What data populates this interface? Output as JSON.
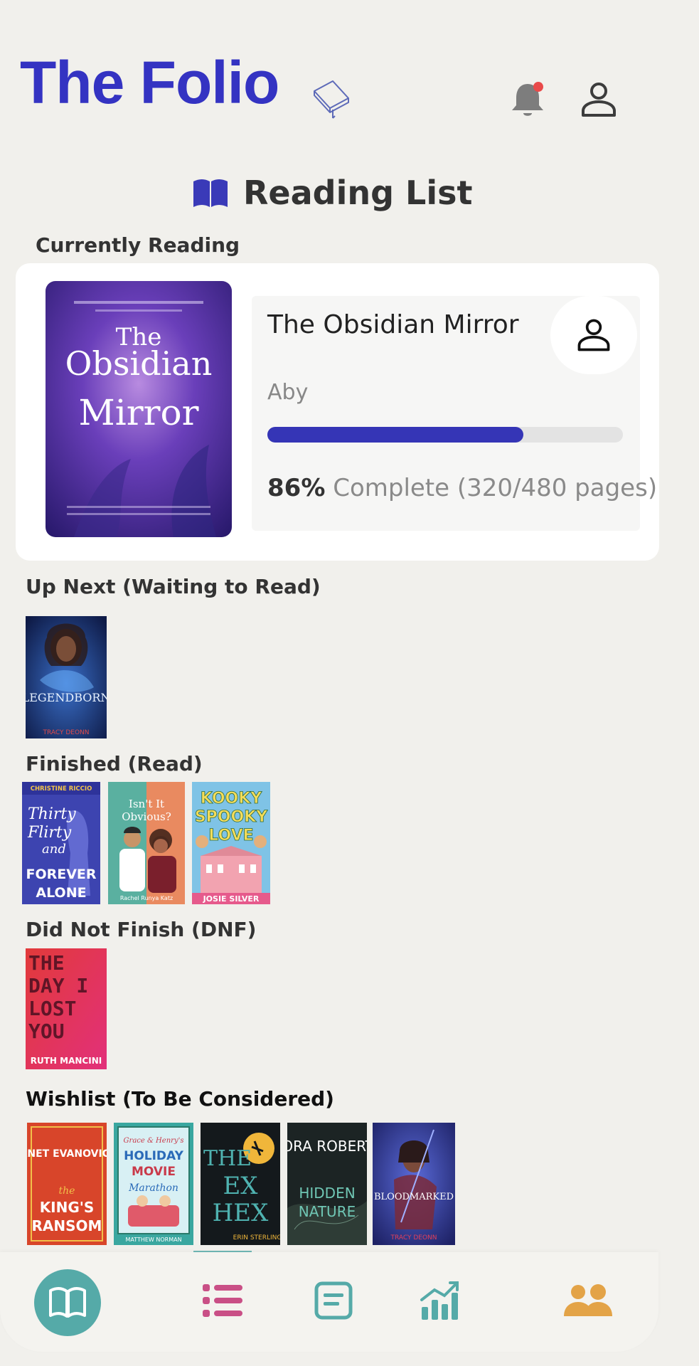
{
  "header": {
    "app_title": "The Folio",
    "logo_icon": "book-icon",
    "notification_icon": "bell-icon",
    "profile_icon": "user-icon"
  },
  "page": {
    "heading": "Reading List",
    "heading_icon": "open-book-icon"
  },
  "sections": {
    "currently_reading": "Currently Reading",
    "up_next": "Up Next (Waiting to Read)",
    "finished": "Finished (Read)",
    "dnf": "Did Not Finish (DNF)",
    "wishlist": "Wishlist (To Be Considered)"
  },
  "current_book": {
    "title": "The Obsidian Mirror",
    "cover_text": [
      "The",
      "Obsidian",
      "Mirror"
    ],
    "author": "Aby",
    "progress_percent": 86,
    "progress_fill_fraction": 0.72,
    "progress_pct_label": "86%",
    "progress_rest_label": " Complete (320/480 pages)"
  },
  "up_next": [
    {
      "title": "LEGENDBORN",
      "author": "TRACY DEONN"
    }
  ],
  "finished": [
    {
      "author": "CHRISTINE RICCIO",
      "title": [
        "Thirty",
        "Flirty",
        "and",
        "FOREVER",
        "ALONE"
      ]
    },
    {
      "title": [
        "Isn't It",
        "Obvious?"
      ],
      "author": "Rachel Runya Katz"
    },
    {
      "title": [
        "KOOKY",
        "SPOOKY",
        "LOVE"
      ],
      "author": "JOSIE SILVER"
    }
  ],
  "dnf": [
    {
      "title": [
        "THE",
        "DAY I",
        "LOST",
        "YOU"
      ],
      "author": "RUTH MANCINI"
    }
  ],
  "wishlist": [
    {
      "author_top": "JANET EVANOVICH",
      "title": [
        "the",
        "KING'S",
        "RANSOM"
      ]
    },
    {
      "title": [
        "Grace & Henry's",
        "HOLIDAY",
        "MOVIE",
        "Marathon"
      ],
      "author": "MATTHEW NORMAN"
    },
    {
      "title": [
        "THE",
        "EX",
        "HEX"
      ],
      "author": "ERIN STERLING"
    },
    {
      "author_top": "NORA ROBERTS",
      "title": [
        "HIDDEN",
        "NATURE"
      ]
    },
    {
      "title": [
        "BLOODMARKED"
      ],
      "author": "TRACY DEONN"
    }
  ],
  "nav": {
    "items": [
      "home-book-icon",
      "list-icon",
      "notes-icon",
      "stats-icon",
      "people-icon"
    ],
    "active": "list-icon"
  },
  "colors": {
    "brand": "#3433c2",
    "progress": "#3535b6",
    "accent_teal": "#55aaa8",
    "accent_pink": "#c94f86",
    "accent_orange": "#e3a347"
  }
}
